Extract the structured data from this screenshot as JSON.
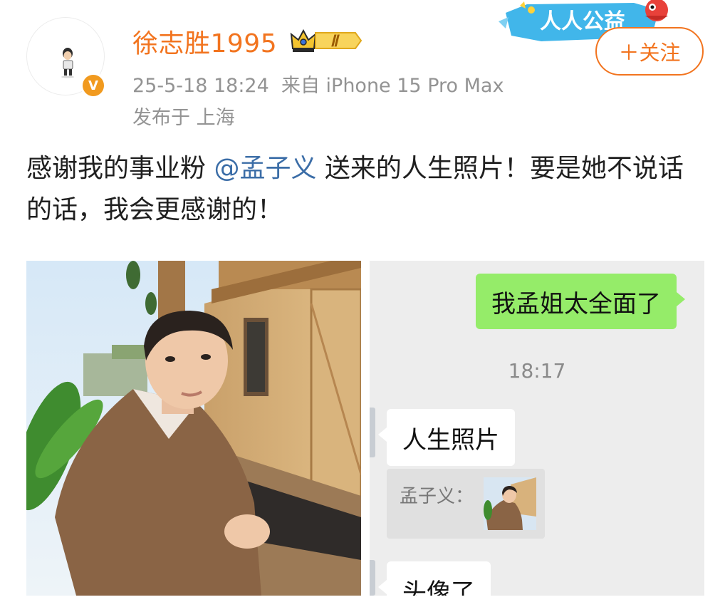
{
  "user": {
    "name": "徐志胜1995",
    "level": "Ⅱ",
    "verified_mark": "V",
    "timestamp": "25-5-18 18:24",
    "source": "来自 iPhone 15 Pro Max",
    "location": "发布于 上海"
  },
  "banner": {
    "text": "人人公益"
  },
  "follow_button": {
    "label": "＋关注"
  },
  "post": {
    "text_before": "感谢我的事业粉 ",
    "mention": "@孟子义",
    "text_after": " 送来的人生照片！要是她不说话的话，我会更感谢的！"
  },
  "chat": {
    "sent_message": "我孟姐太全面了",
    "time": "18:17",
    "received_message_1": "人生照片",
    "quote_label": "孟子义：",
    "received_message_2": "头像了"
  },
  "colors": {
    "accent_orange": "#f2741f",
    "mention_blue": "#3b6da7",
    "wechat_green": "#95ec69",
    "meta_gray": "#939393"
  },
  "icons": {
    "verified": "verified-v-icon",
    "level": "crown-level-icon",
    "banner": "charity-mascot-icon"
  }
}
